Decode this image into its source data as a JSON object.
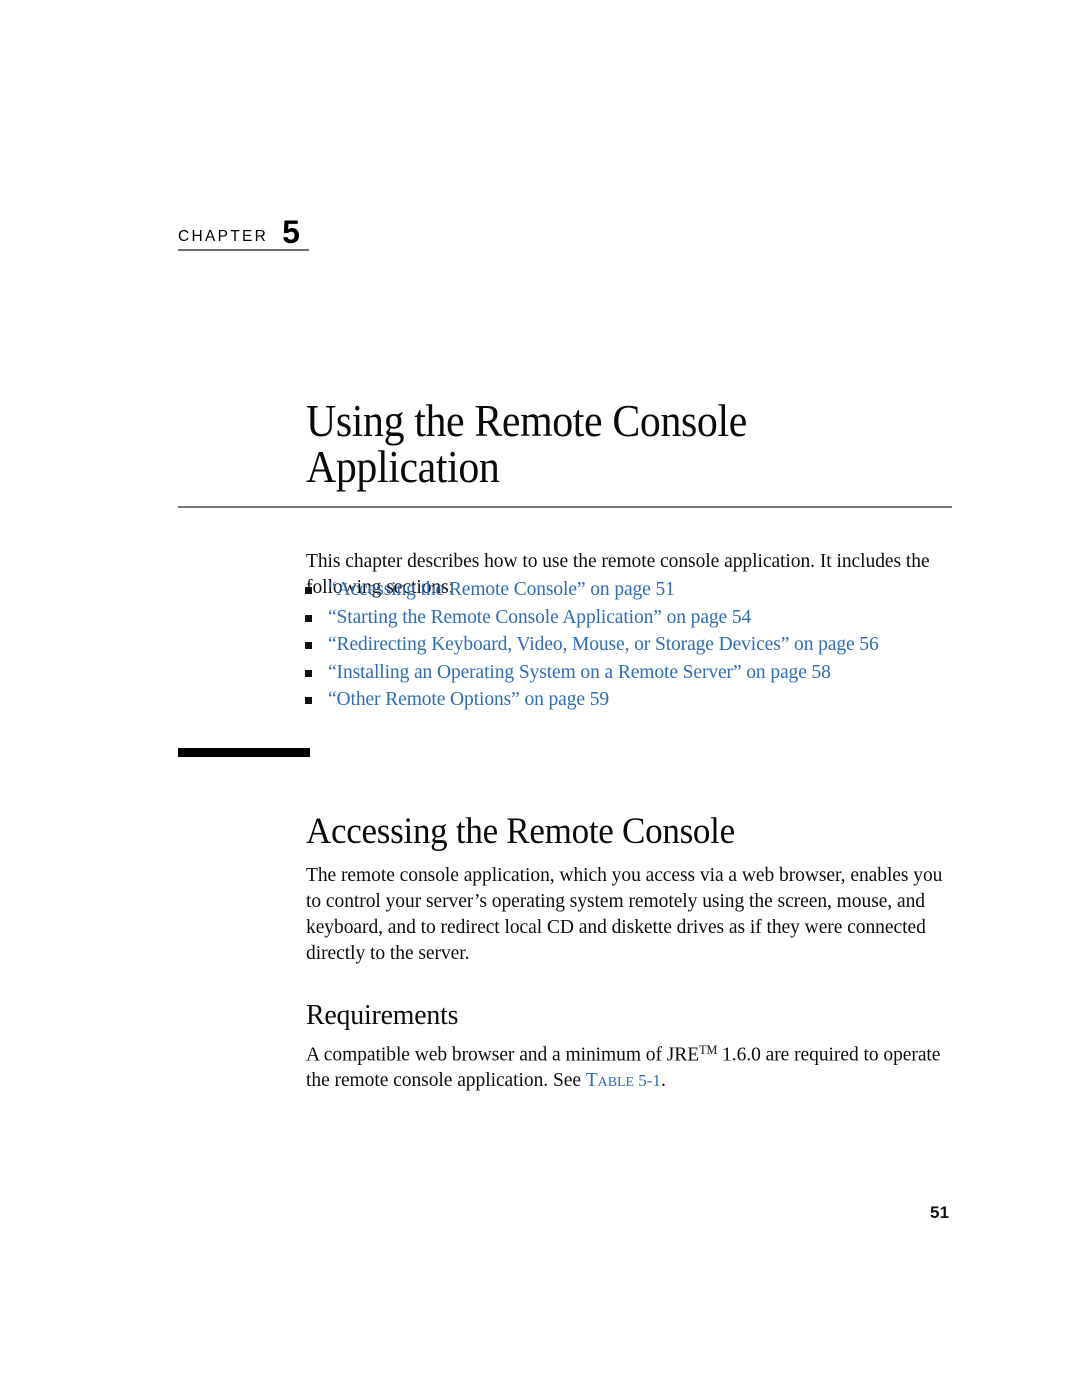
{
  "document": {
    "type": "book-chapter-opening-page",
    "page_number": "51",
    "accent_link_color": "#2f6cb4",
    "rule_color": "#77777c",
    "bar_color": "#000000"
  },
  "chapter_label": {
    "word": "CHAPTER",
    "number": "5"
  },
  "chapter_title": {
    "full": "Using the Remote Console Application",
    "lines": [
      "Using the Remote Console",
      "Application"
    ]
  },
  "intro": {
    "paragraph": "This chapter describes how to use the remote console application. It includes the following sections:"
  },
  "toc": {
    "items": [
      {
        "label": "“Accessing the Remote Console” on page 51"
      },
      {
        "label": "“Starting the Remote Console Application” on page 54"
      },
      {
        "label": "“Redirecting Keyboard, Video, Mouse, or Storage Devices” on page 56"
      },
      {
        "label": "“Installing an Operating System on a Remote Server” on page 58"
      },
      {
        "label": "“Other Remote Options” on page 59"
      }
    ]
  },
  "section": {
    "heading": "Accessing the Remote Console",
    "paragraph": "The remote console application, which you access via a web browser, enables you to control your server’s operating system remotely using the screen, mouse, and keyboard, and to redirect local CD and diskette drives as if they were connected directly to the server."
  },
  "subsection": {
    "heading": "Requirements",
    "paragraph_part1": "A compatible web browser and a minimum of JRE",
    "trademark": "TM",
    "paragraph_part2": " 1.6.0 are required to operate the remote console application. See ",
    "xref_word": "Table",
    "xref_number": " 5-1",
    "paragraph_part3": "."
  },
  "footer": {
    "page_number": "51"
  }
}
